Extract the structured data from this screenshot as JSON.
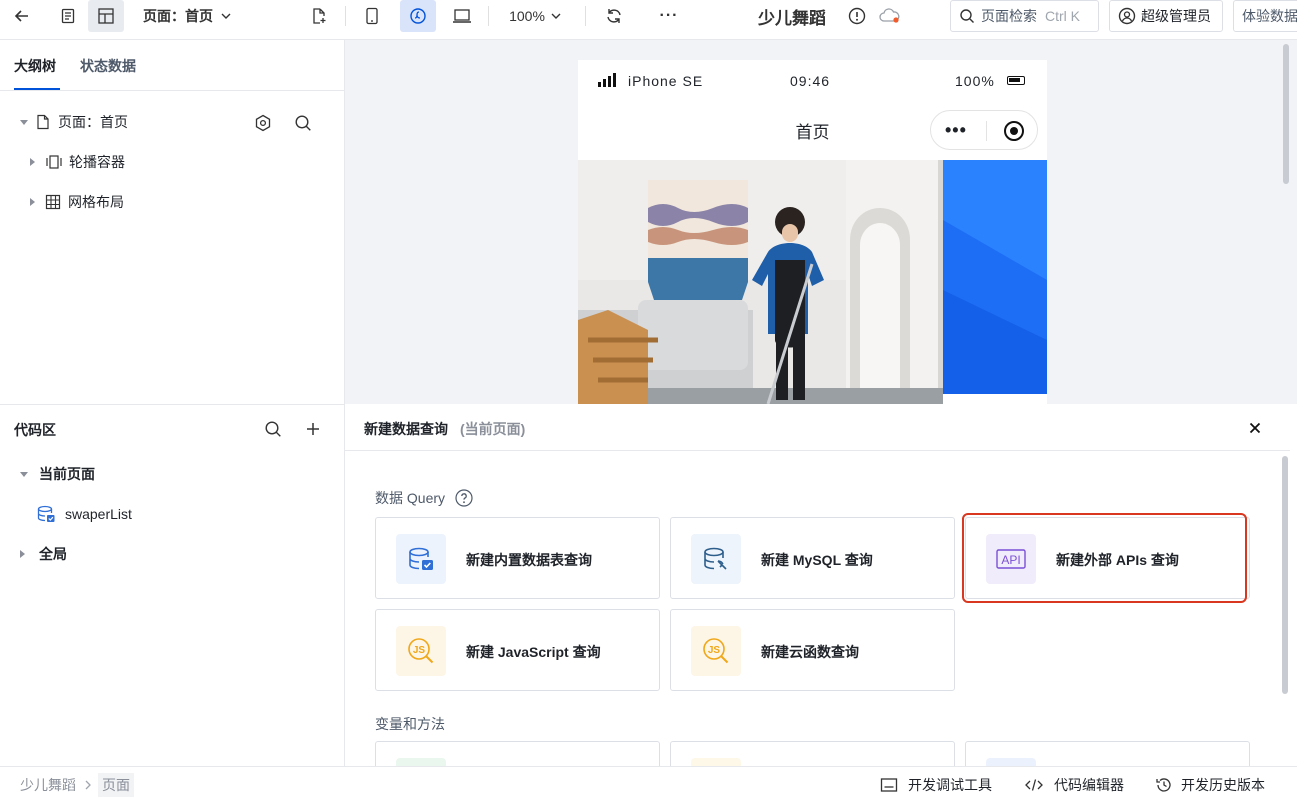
{
  "topbar": {
    "page_label": "页面：首页",
    "zoom": "100%",
    "app_title": "少儿舞蹈",
    "search_label": "页面检索",
    "search_shortcut": "Ctrl K",
    "user_label": "超级管理员",
    "trial_label": "体验数据"
  },
  "outline": {
    "tab_outline": "大纲树",
    "tab_state": "状态数据",
    "root_label": "页面：首页",
    "items": [
      {
        "label": "轮播容器",
        "icon": "carousel-icon"
      },
      {
        "label": "网格布局",
        "icon": "grid-icon"
      }
    ]
  },
  "code": {
    "title": "代码区",
    "current_page": "当前页面",
    "query_item": "swaperList",
    "global": "全局"
  },
  "phone": {
    "carrier": "iPhone SE",
    "time": "09:46",
    "battery": "100%",
    "nav_title": "首页"
  },
  "panel": {
    "title": "新建数据查询",
    "subtitle": "(当前页面)",
    "section_query": "数据 Query",
    "section_vars": "变量和方法",
    "cards": [
      {
        "label": "新建内置数据表查询",
        "icon": "builtin-db-icon",
        "bg": "#edf3fd"
      },
      {
        "label": "新建 MySQL 查询",
        "icon": "mysql-db-icon",
        "bg": "#eef4fb"
      },
      {
        "label": "新建外部 APIs 查询",
        "icon": "api-icon",
        "bg": "#f1ecfb"
      },
      {
        "label": "新建 JavaScript 查询",
        "icon": "js-icon",
        "bg": "#fdf6e7"
      },
      {
        "label": "新建云函数查询",
        "icon": "cloud-function-icon",
        "bg": "#fdf6e7"
      }
    ]
  },
  "statusbar": {
    "breadcrumb_app": "少儿舞蹈",
    "breadcrumb_page": "页面",
    "debug_tools": "开发调试工具",
    "code_editor": "代码编辑器",
    "history": "开发历史版本"
  },
  "colors": {
    "accent": "#0052d9",
    "highlight_border": "#d9371f",
    "js_yellow": "#f0a719",
    "api_purple": "#7b4fd6"
  }
}
